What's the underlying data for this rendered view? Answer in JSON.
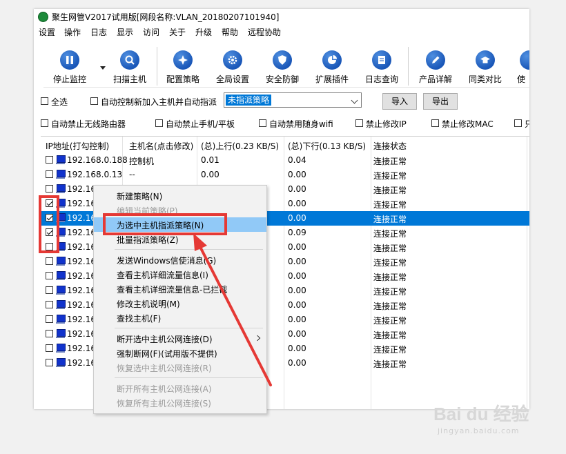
{
  "window": {
    "title": "聚生网管V2017试用版[网段名称:VLAN_20180207101940]"
  },
  "menubar": [
    "设置",
    "操作",
    "日志",
    "显示",
    "访问",
    "关于",
    "升级",
    "帮助",
    "远程协助"
  ],
  "toolbar": [
    {
      "label": "停止监控",
      "icon": "pause-icon"
    },
    {
      "label": "扫描主机",
      "icon": "search-icon"
    },
    {
      "label": "配置策略",
      "icon": "policy-icon"
    },
    {
      "label": "全局设置",
      "icon": "gear-icon"
    },
    {
      "label": "安全防御",
      "icon": "shield-icon"
    },
    {
      "label": "扩展插件",
      "icon": "pie-chart-icon"
    },
    {
      "label": "日志查询",
      "icon": "log-icon"
    },
    {
      "label": "产品详解",
      "icon": "edit-icon"
    },
    {
      "label": "同类对比",
      "icon": "graduation-cap-icon"
    },
    {
      "label": "使",
      "icon": "user-icon"
    }
  ],
  "options": {
    "select_all": "全选",
    "auto_control": "自动控制新加入主机并自动指派",
    "policy_value": "未指派策略",
    "import_label": "导入",
    "export_label": "导出",
    "checks": [
      "自动禁止无线路由器",
      "自动禁止手机/平板",
      "自动禁用随身wifi",
      "禁止修改IP",
      "禁止修改MAC",
      "只"
    ]
  },
  "grid": {
    "columns": [
      "IP地址(打勾控制)",
      "主机名(点击修改)",
      "(总)上行(0.23 KB/S)",
      "(总)下行(0.13 KB/S)",
      "连接状态"
    ],
    "rows": [
      {
        "ip": "192.168.0.188",
        "host": "控制机",
        "up": "0.01",
        "down": "0.04",
        "status": "连接正常",
        "checked": false,
        "selected": false
      },
      {
        "ip": "192.168.0.13",
        "host": "--",
        "up": "0.00",
        "down": "0.00",
        "status": "连接正常",
        "checked": false,
        "selected": false
      },
      {
        "ip": "192.16",
        "host": "",
        "up": "",
        "down": "0.00",
        "status": "连接正常",
        "checked": false,
        "selected": false
      },
      {
        "ip": "192.16",
        "host": "",
        "up": "",
        "down": "0.00",
        "status": "连接正常",
        "checked": true,
        "selected": false
      },
      {
        "ip": "192.16",
        "host": "",
        "up": "",
        "down": "0.00",
        "status": "连接正常",
        "checked": true,
        "selected": true
      },
      {
        "ip": "192.16",
        "host": "",
        "up": "",
        "down": "0.09",
        "status": "连接正常",
        "checked": true,
        "selected": false
      },
      {
        "ip": "192.16",
        "host": "",
        "up": "",
        "down": "0.00",
        "status": "连接正常",
        "checked": false,
        "selected": false
      },
      {
        "ip": "192.16",
        "host": "",
        "up": "",
        "down": "0.00",
        "status": "连接正常",
        "checked": false,
        "selected": false
      },
      {
        "ip": "192.16",
        "host": "",
        "up": "",
        "down": "0.00",
        "status": "连接正常",
        "checked": false,
        "selected": false
      },
      {
        "ip": "192.16",
        "host": "",
        "up": "",
        "down": "0.00",
        "status": "连接正常",
        "checked": false,
        "selected": false
      },
      {
        "ip": "192.16",
        "host": "",
        "up": "",
        "down": "0.00",
        "status": "连接正常",
        "checked": false,
        "selected": false
      },
      {
        "ip": "192.16",
        "host": "",
        "up": "",
        "down": "0.00",
        "status": "连接正常",
        "checked": false,
        "selected": false
      },
      {
        "ip": "192.16",
        "host": "",
        "up": "",
        "down": "0.00",
        "status": "连接正常",
        "checked": false,
        "selected": false
      },
      {
        "ip": "192.16",
        "host": "",
        "up": "",
        "down": "0.00",
        "status": "连接正常",
        "checked": false,
        "selected": false
      },
      {
        "ip": "192.16",
        "host": "",
        "up": "",
        "down": "0.00",
        "status": "连接正常",
        "checked": false,
        "selected": false
      }
    ]
  },
  "context_menu": [
    {
      "label": "新建策略(N)",
      "disabled": false
    },
    {
      "label": "编辑当前策略(P)",
      "disabled": true
    },
    {
      "label": "为选中主机指派策略(N)",
      "disabled": false,
      "highlighted": true
    },
    {
      "label": "批量指派策略(Z)",
      "disabled": false
    },
    {
      "sep": true
    },
    {
      "label": "发送Windows信使消息(G)",
      "disabled": false
    },
    {
      "label": "查看主机详细流量信息(I)",
      "disabled": false
    },
    {
      "label": "查看主机详细流量信息-已拦截",
      "disabled": false
    },
    {
      "label": "修改主机说明(M)",
      "disabled": false
    },
    {
      "label": "查找主机(F)",
      "disabled": false
    },
    {
      "sep": true
    },
    {
      "label": "断开选中主机公网连接(D)",
      "disabled": false,
      "submenu": true
    },
    {
      "label": "强制断网(F)(试用版不提供)",
      "disabled": false
    },
    {
      "label": "恢复选中主机公网连接(R)",
      "disabled": true
    },
    {
      "sep": true
    },
    {
      "label": "断开所有主机公网连接(A)",
      "disabled": true
    },
    {
      "label": "恢复所有主机公网连接(S)",
      "disabled": true
    }
  ],
  "watermark": {
    "main": "Bai du 经验",
    "sub": "jingyan.baidu.com"
  },
  "colors": {
    "selection": "#0078d7",
    "menu_highlight": "#91c9f7",
    "annotation": "#e53935"
  }
}
